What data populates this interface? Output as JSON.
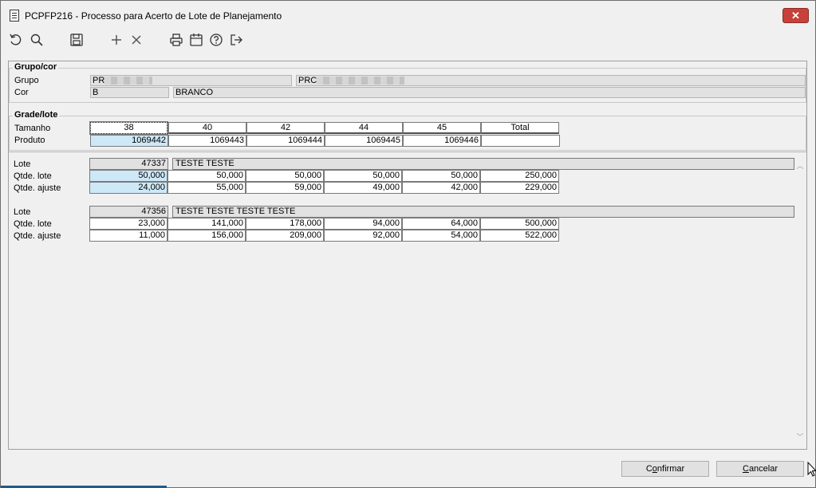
{
  "window": {
    "title": "PCPFP216 - Processo para Acerto de Lote de Planejamento",
    "close_label": "✕"
  },
  "toolbar": {
    "icons": [
      "undo-icon",
      "search-icon",
      "save-icon",
      "add-icon",
      "delete-icon",
      "print-icon",
      "calendar-icon",
      "help-icon",
      "exit-icon"
    ]
  },
  "grupo_cor": {
    "title": "Grupo/cor",
    "grupo_label": "Grupo",
    "grupo_code": "PR",
    "grupo_desc": "PRC",
    "cor_label": "Cor",
    "cor_code": "B",
    "cor_desc": "BRANCO"
  },
  "grade_lote": {
    "title": "Grade/lote",
    "tamanho_label": "Tamanho",
    "produto_label": "Produto",
    "sizes": [
      "38",
      "40",
      "42",
      "44",
      "45",
      "Total"
    ],
    "produtos": [
      "1069442",
      "1069443",
      "1069444",
      "1069445",
      "1069446",
      ""
    ]
  },
  "lotes": [
    {
      "lote_label": "Lote",
      "lote_num": "47337",
      "lote_desc": "TESTE TESTE",
      "qtde_lote_label": "Qtde. lote",
      "qtde_lote": [
        "50,000",
        "50,000",
        "50,000",
        "50,000",
        "50,000",
        "250,000"
      ],
      "qtde_ajuste_label": "Qtde. ajuste",
      "qtde_ajuste": [
        "24,000",
        "55,000",
        "59,000",
        "49,000",
        "42,000",
        "229,000"
      ]
    },
    {
      "lote_label": "Lote",
      "lote_num": "47356",
      "lote_desc": "TESTE TESTE TESTE TESTE",
      "qtde_lote_label": "Qtde. lote",
      "qtde_lote": [
        "23,000",
        "141,000",
        "178,000",
        "94,000",
        "64,000",
        "500,000"
      ],
      "qtde_ajuste_label": "Qtde. ajuste",
      "qtde_ajuste": [
        "11,000",
        "156,000",
        "209,000",
        "92,000",
        "54,000",
        "522,000"
      ]
    }
  ],
  "buttons": {
    "confirmar_pre": "C",
    "confirmar_u": "o",
    "confirmar_post": "nfirmar",
    "cancelar_pre": "",
    "cancelar_u": "C",
    "cancelar_post": "ancelar"
  }
}
